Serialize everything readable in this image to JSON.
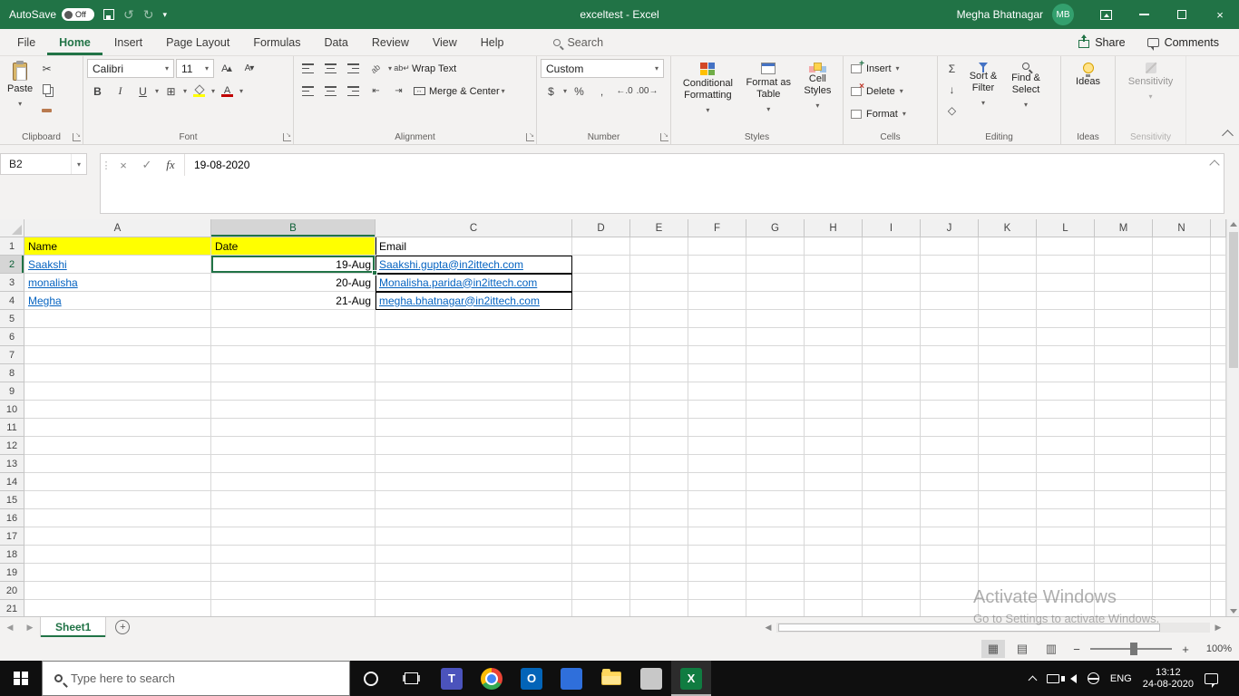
{
  "titlebar": {
    "autosave_label": "AutoSave",
    "autosave_state": "Off",
    "title": "exceltest  -  Excel",
    "user_name": "Megha Bhatnagar",
    "user_initials": "MB"
  },
  "tabs_bar": {
    "file": "File",
    "tabs": [
      "Home",
      "Insert",
      "Page Layout",
      "Formulas",
      "Data",
      "Review",
      "View",
      "Help"
    ],
    "active_tab": "Home",
    "search": "Search",
    "share": "Share",
    "comments": "Comments"
  },
  "ribbon": {
    "clipboard": {
      "group": "Clipboard",
      "paste": "Paste"
    },
    "font": {
      "group": "Font",
      "name": "Calibri",
      "size": "11"
    },
    "alignment": {
      "group": "Alignment",
      "wrap": "Wrap Text",
      "merge": "Merge & Center"
    },
    "number": {
      "group": "Number",
      "format": "Custom"
    },
    "styles": {
      "group": "Styles",
      "conditional": "Conditional Formatting",
      "format_table": "Format as Table",
      "cell_styles": "Cell Styles"
    },
    "cells": {
      "group": "Cells",
      "insert": "Insert",
      "delete": "Delete",
      "format": "Format"
    },
    "editing": {
      "group": "Editing",
      "sort_filter": "Sort & Filter",
      "find_select": "Find & Select"
    },
    "ideas": {
      "group": "Ideas",
      "button": "Ideas"
    },
    "sensitivity": {
      "group": "Sensitivity",
      "button": "Sensitivity"
    }
  },
  "formula_bar": {
    "name_box": "B2",
    "value": "19-08-2020"
  },
  "sheet": {
    "columns": [
      "A",
      "B",
      "C",
      "D",
      "E",
      "F",
      "G",
      "H",
      "I",
      "J",
      "K",
      "L",
      "M",
      "N"
    ],
    "active_column": "B",
    "active_row": 2,
    "num_rows": 21,
    "header_row": {
      "a": "Name",
      "b": "Date",
      "c": "Email"
    },
    "records": [
      {
        "row": 2,
        "name": "Saakshi",
        "date": "19-Aug",
        "email": "Saakshi.gupta@in2ittech.com"
      },
      {
        "row": 3,
        "name": "monalisha",
        "date": "20-Aug",
        "email": "Monalisha.parida@in2ittech.com"
      },
      {
        "row": 4,
        "name": "Megha",
        "date": "21-Aug",
        "email": "megha.bhatnagar@in2ittech.com"
      }
    ]
  },
  "sheet_tabs": {
    "active": "Sheet1"
  },
  "status_bar": {
    "zoom_level": "100%"
  },
  "watermark": {
    "line1": "Activate Windows",
    "line2": "Go to Settings to activate Windows."
  },
  "taskbar": {
    "search_placeholder": "Type here to search",
    "apps": [
      "teams",
      "chrome",
      "outlook",
      "app-blue",
      "file-explorer",
      "app-gray",
      "excel"
    ],
    "active_app": "excel",
    "tray": {
      "lang": "ENG",
      "time": "13:12",
      "date": "24-08-2020"
    }
  },
  "colors": {
    "excel_green": "#217346",
    "header_fill_yellow": "#ffff00",
    "hyperlink_blue": "#0563c1"
  }
}
